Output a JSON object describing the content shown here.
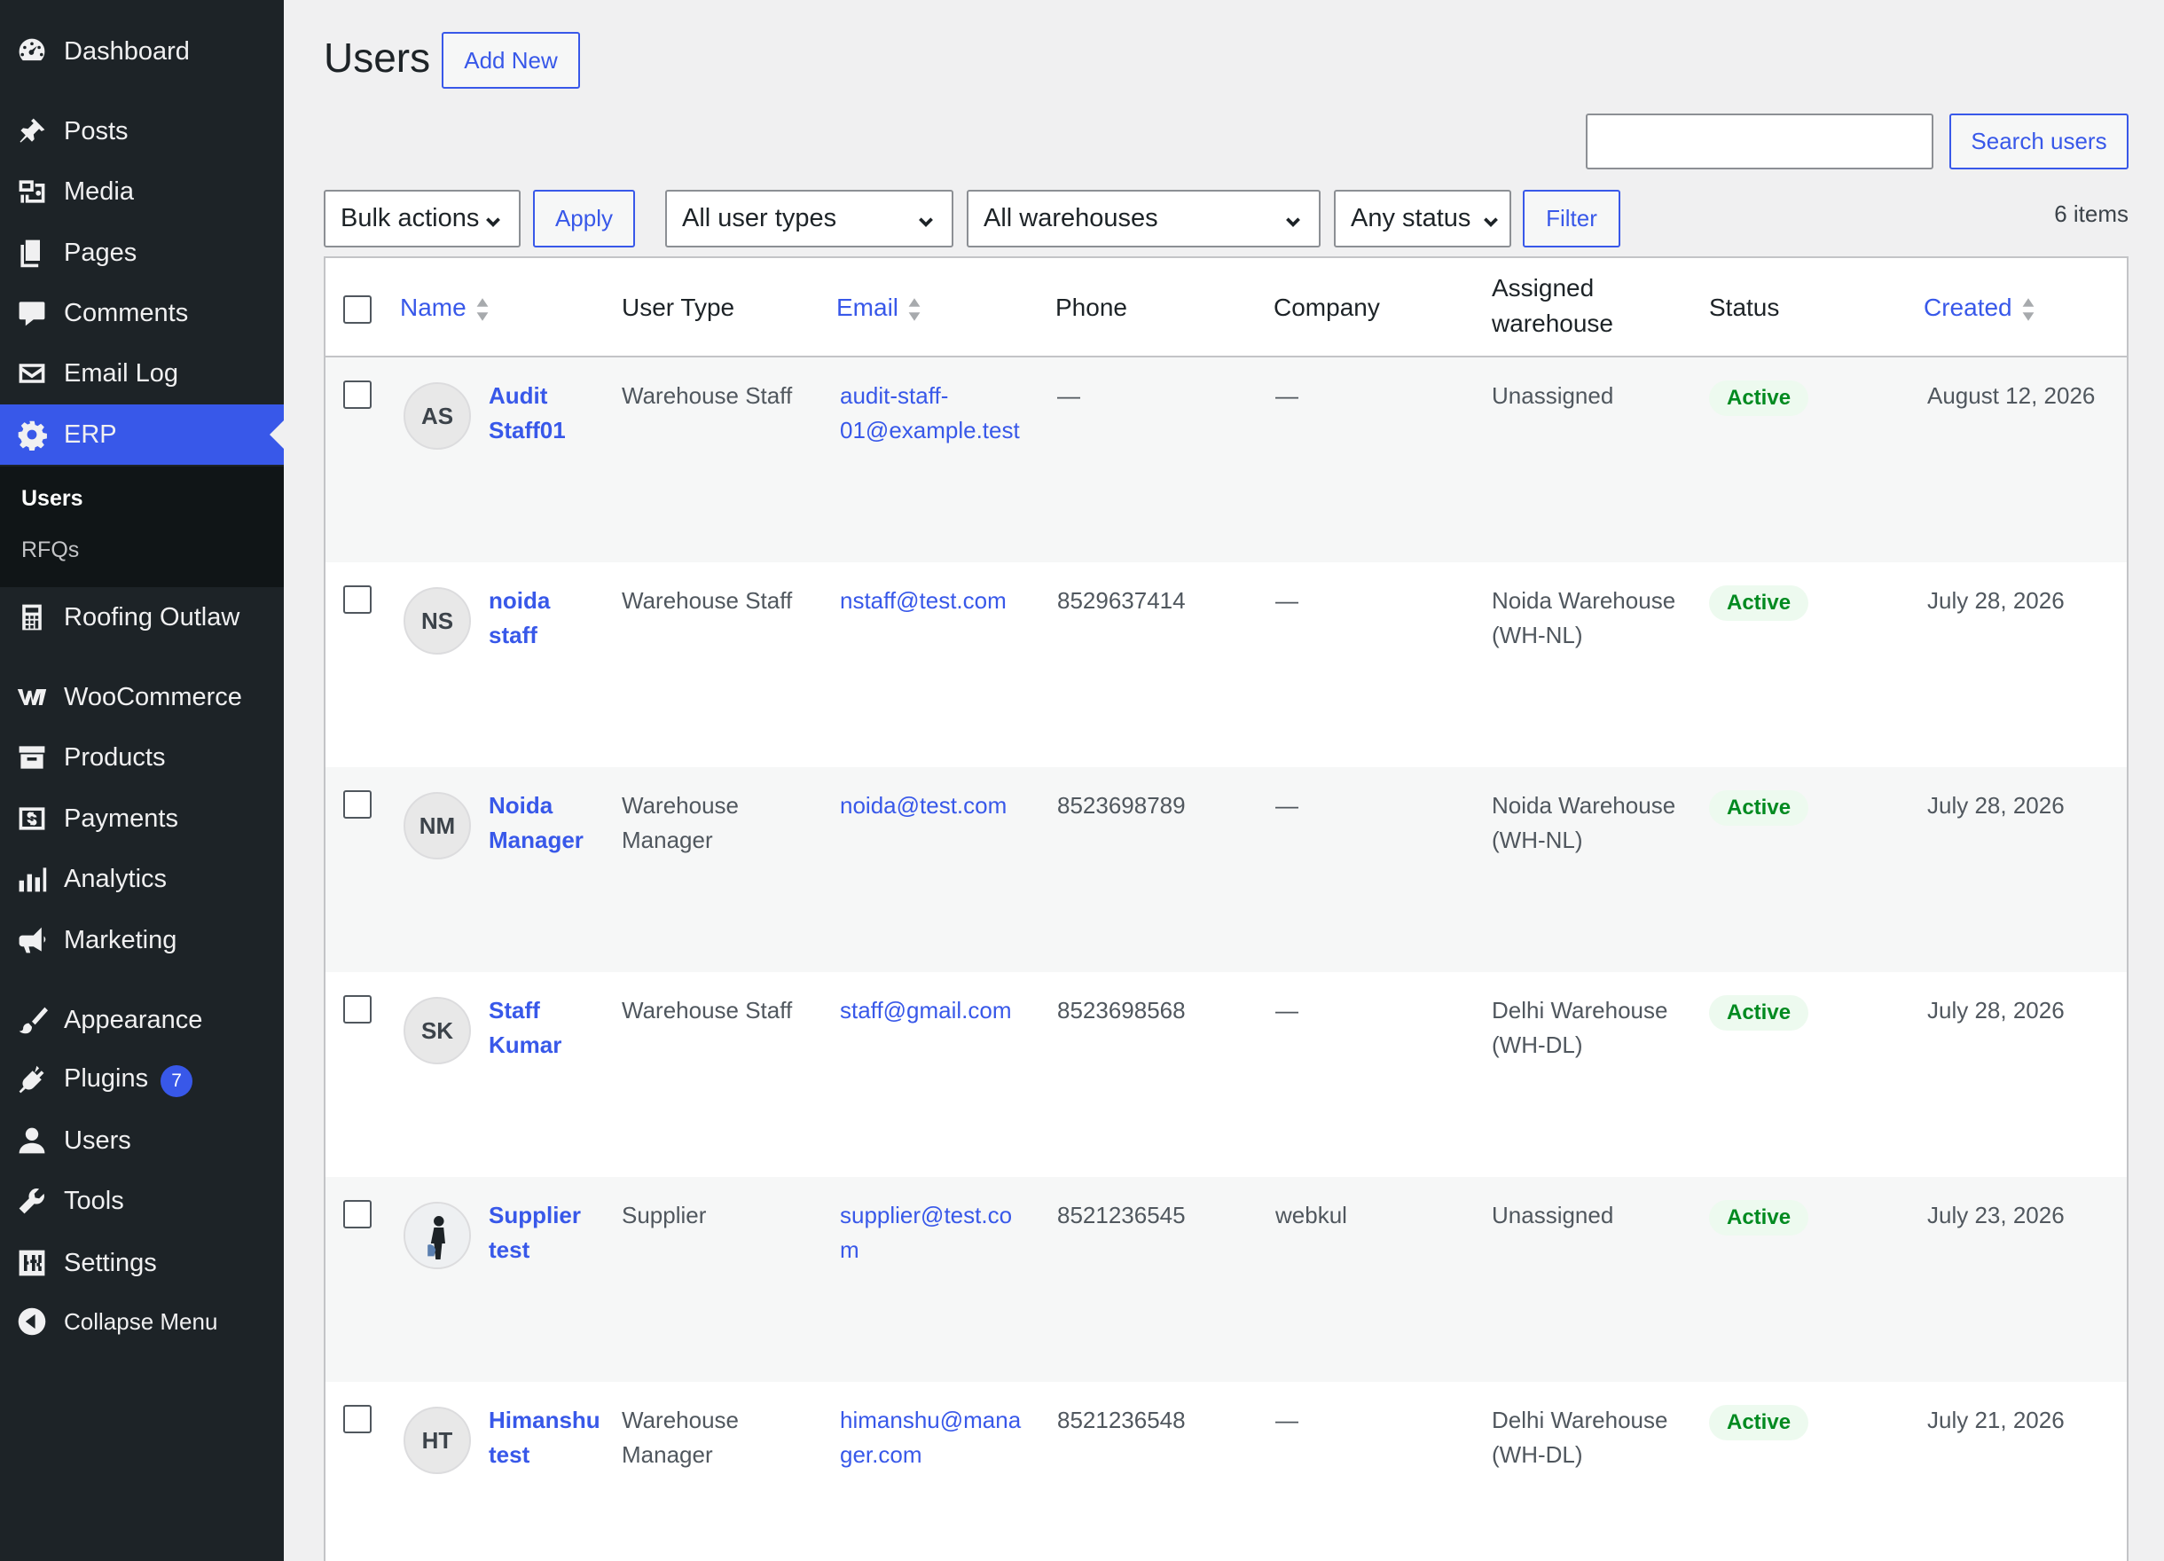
{
  "sidebar": {
    "items": [
      {
        "key": "dashboard",
        "label": "Dashboard",
        "icon": "dashboard-icon"
      },
      {
        "key": "posts",
        "label": "Posts",
        "icon": "pin-icon"
      },
      {
        "key": "media",
        "label": "Media",
        "icon": "media-icon"
      },
      {
        "key": "pages",
        "label": "Pages",
        "icon": "pages-icon"
      },
      {
        "key": "comments",
        "label": "Comments",
        "icon": "comment-icon"
      },
      {
        "key": "email-log",
        "label": "Email Log",
        "icon": "envelope-icon"
      },
      {
        "key": "erp",
        "label": "ERP",
        "icon": "gear-icon"
      },
      {
        "key": "roofing",
        "label": "Roofing Outlaw",
        "icon": "calculator-icon"
      },
      {
        "key": "woocommerce",
        "label": "WooCommerce",
        "icon": "woo-icon"
      },
      {
        "key": "products",
        "label": "Products",
        "icon": "archive-icon"
      },
      {
        "key": "payments",
        "label": "Payments",
        "icon": "dollar-icon"
      },
      {
        "key": "analytics",
        "label": "Analytics",
        "icon": "bar-chart-icon"
      },
      {
        "key": "marketing",
        "label": "Marketing",
        "icon": "megaphone-icon"
      },
      {
        "key": "appearance",
        "label": "Appearance",
        "icon": "brush-icon"
      },
      {
        "key": "plugins",
        "label": "Plugins",
        "icon": "plug-icon",
        "badge": "7"
      },
      {
        "key": "users",
        "label": "Users",
        "icon": "user-icon"
      },
      {
        "key": "tools",
        "label": "Tools",
        "icon": "wrench-icon"
      },
      {
        "key": "settings",
        "label": "Settings",
        "icon": "sliders-icon"
      },
      {
        "key": "collapse",
        "label": "Collapse Menu",
        "icon": "collapse-icon"
      }
    ],
    "submenu": [
      {
        "label": "Users",
        "current": true
      },
      {
        "label": "RFQs",
        "current": false
      }
    ]
  },
  "header": {
    "title": "Users",
    "add_new": "Add New"
  },
  "search": {
    "placeholder": "",
    "button": "Search users"
  },
  "filters": {
    "bulk_actions": "Bulk actions",
    "apply": "Apply",
    "user_types": "All user types",
    "warehouses": "All warehouses",
    "status": "Any status",
    "filter": "Filter",
    "items_count": "6 items"
  },
  "table": {
    "columns": {
      "name": "Name",
      "user_type": "User Type",
      "email": "Email",
      "phone": "Phone",
      "company": "Company",
      "warehouse_line1": "Assigned",
      "warehouse_line2": "warehouse",
      "status": "Status",
      "created": "Created"
    },
    "rows": [
      {
        "initials": "AS",
        "name1": "Audit",
        "name2": "Staff01",
        "type1": "Warehouse Staff",
        "type2": "",
        "email1": "audit-staff-",
        "email2": "01@example.test",
        "phone": "—",
        "company": "—",
        "wh1": "Unassigned",
        "wh2": "",
        "status": "Active",
        "created": "August 12, 2026"
      },
      {
        "initials": "NS",
        "name1": "noida",
        "name2": "staff",
        "type1": "Warehouse Staff",
        "type2": "",
        "email1": "nstaff@test.com",
        "email2": "",
        "phone": "8529637414",
        "company": "—",
        "wh1": "Noida Warehouse",
        "wh2": "(WH-NL)",
        "status": "Active",
        "created": "July 28, 2026"
      },
      {
        "initials": "NM",
        "name1": "Noida",
        "name2": "Manager",
        "type1": "Warehouse",
        "type2": "Manager",
        "email1": "noida@test.com",
        "email2": "",
        "phone": "8523698789",
        "company": "—",
        "wh1": "Noida Warehouse",
        "wh2": "(WH-NL)",
        "status": "Active",
        "created": "July 28, 2026"
      },
      {
        "initials": "SK",
        "name1": "Staff",
        "name2": "Kumar",
        "type1": "Warehouse Staff",
        "type2": "",
        "email1": "staff@gmail.com",
        "email2": "",
        "phone": "8523698568",
        "company": "—",
        "wh1": "Delhi Warehouse",
        "wh2": "(WH-DL)",
        "status": "Active",
        "created": "July 28, 2026"
      },
      {
        "initials": "",
        "photo": true,
        "name1": "Supplier",
        "name2": "test",
        "type1": "Supplier",
        "type2": "",
        "email1": "supplier@test.co",
        "email2": "m",
        "phone": "8521236545",
        "company": "webkul",
        "wh1": "Unassigned",
        "wh2": "",
        "status": "Active",
        "created": "July 23, 2026"
      },
      {
        "initials": "HT",
        "name1": "Himanshu",
        "name2": "test",
        "type1": "Warehouse",
        "type2": "Manager",
        "email1": "himanshu@mana",
        "email2": "ger.com",
        "phone": "8521236548",
        "company": "—",
        "wh1": "Delhi Warehouse",
        "wh2": "(WH-DL)",
        "status": "Active",
        "created": "July 21, 2026"
      }
    ]
  },
  "colors": {
    "sidebar_bg": "#1d2327",
    "accent": "#3858e9",
    "status_green": "#008a20"
  }
}
